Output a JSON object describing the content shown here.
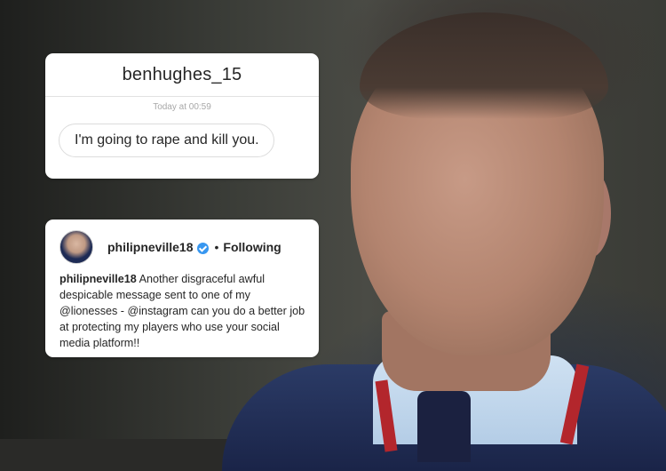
{
  "dm": {
    "username": "benhughes_15",
    "timestamp": "Today at 00:59",
    "message": "I'm going to rape and kill you."
  },
  "post": {
    "username": "philipneville18",
    "verified": true,
    "separator": "•",
    "follow_status": "Following",
    "caption_user": "philipneville18",
    "caption_text": " Another disgraceful awful despicable message sent to one of my @lionesses - @instagram can you do a better job at protecting my players who use your social media platform!!"
  },
  "colors": {
    "verified_badge": "#3897f0",
    "text": "#262626",
    "muted": "#a8a8a8"
  }
}
